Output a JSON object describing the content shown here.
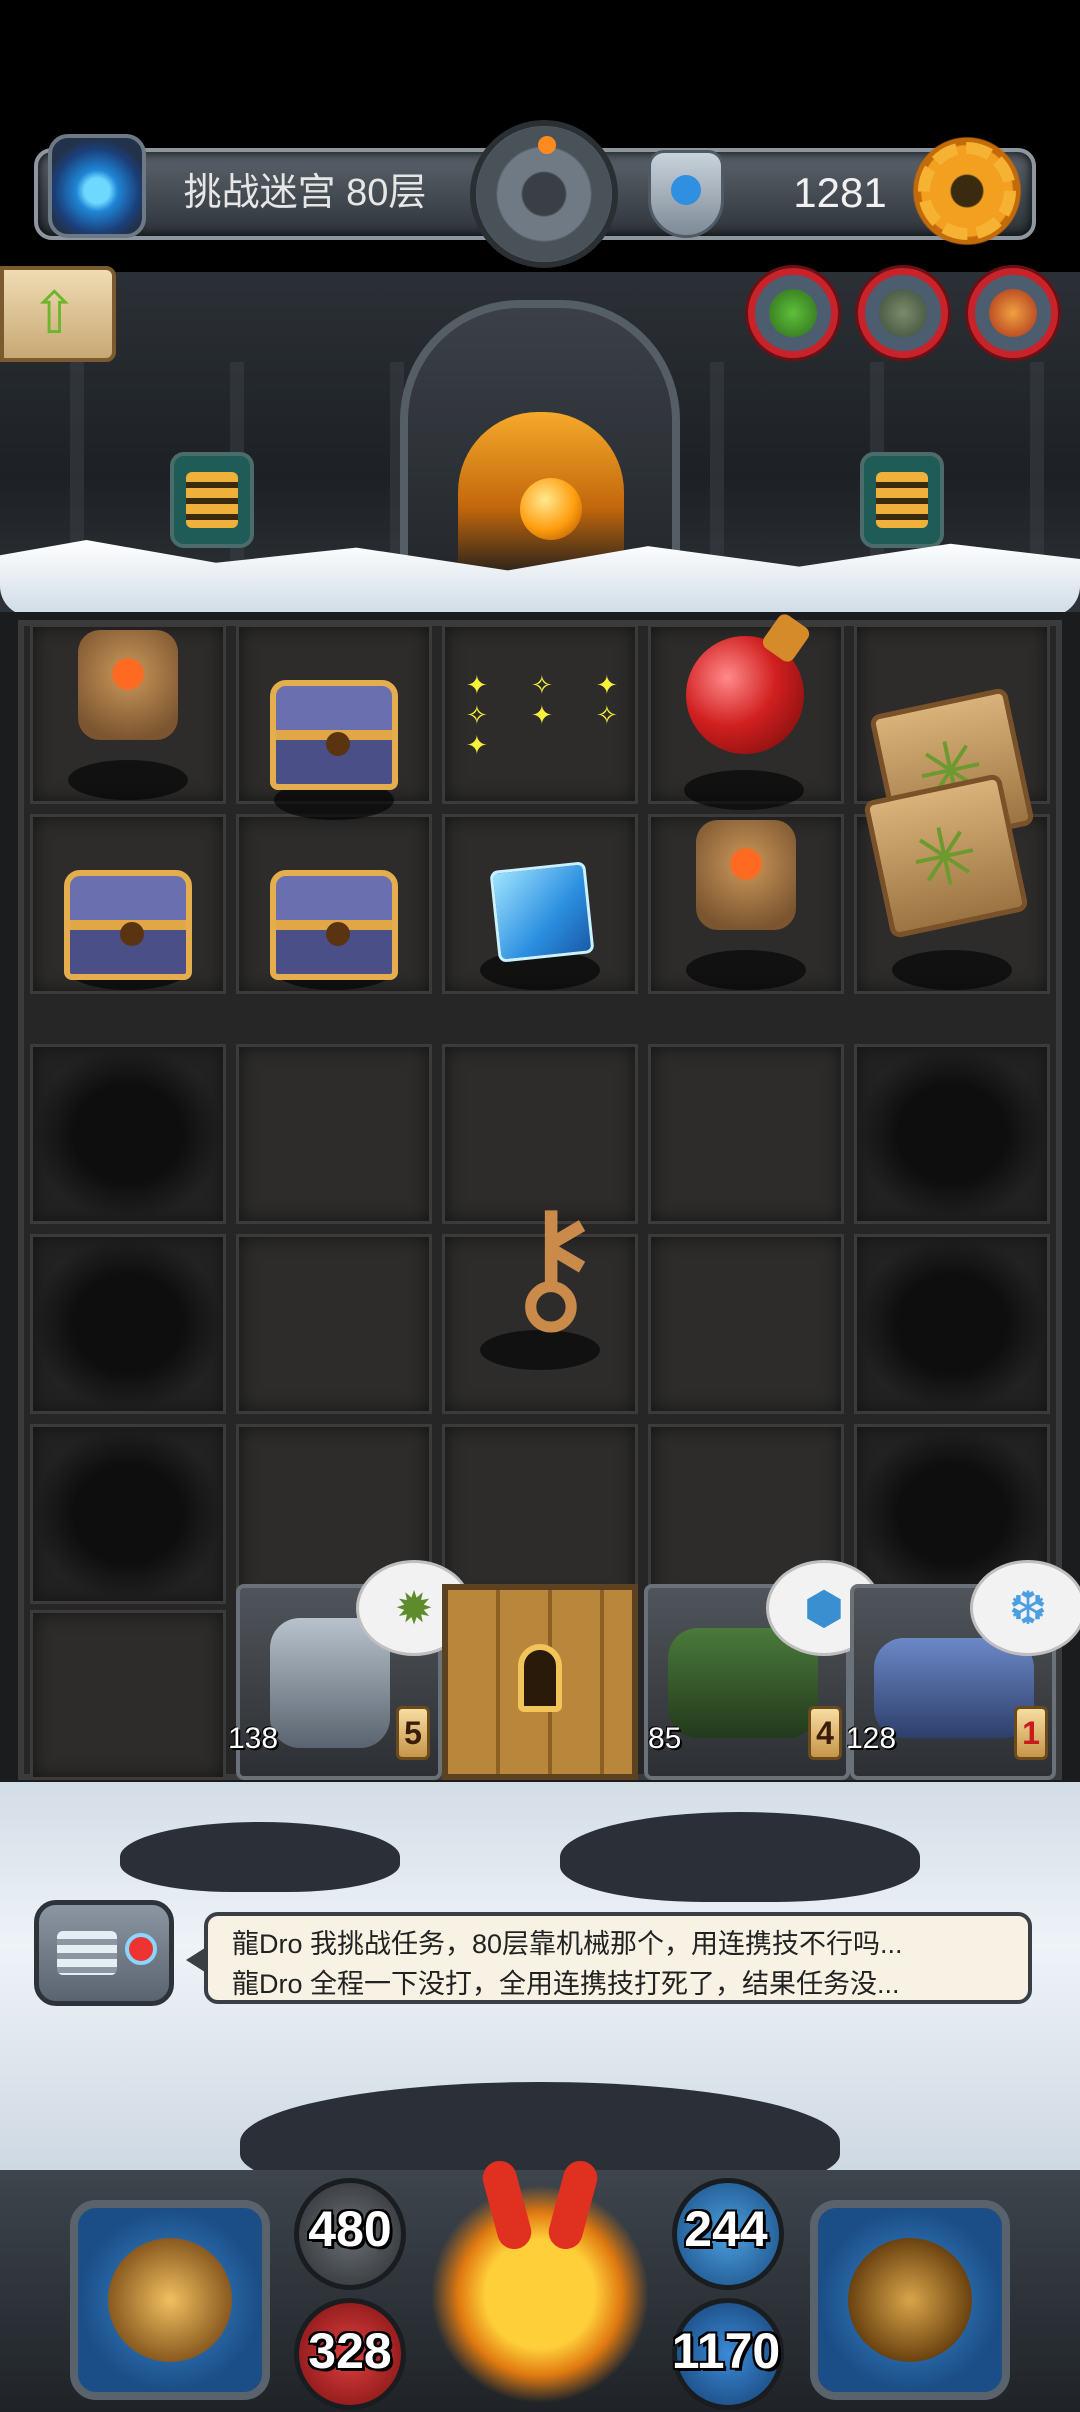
{
  "header": {
    "floor_label": "挑战迷宫 80层",
    "gold": "1281",
    "icons": {
      "portal": "portal-icon",
      "emblem": "bomb-emblem-icon",
      "mask": "mask-icon",
      "settings": "gear-icon"
    }
  },
  "nav": {
    "up_icon": "arrow-up-icon"
  },
  "monsters": [
    "green-goblin",
    "grey-troll",
    "red-imp"
  ],
  "board": {
    "items": [
      "fire-stone",
      "treasure-chest",
      "sparkles",
      "red-potion",
      "scroll",
      "treasure-chest",
      "treasure-chest",
      "ice-cube",
      "fire-stone",
      "scroll",
      "key"
    ]
  },
  "units": {
    "mech": {
      "attack": "138",
      "count": "5",
      "bubble_icon": "grenade-icon"
    },
    "tank": {
      "attack": "85",
      "count": "4",
      "bubble_icon": "turtle-shell-icon"
    },
    "cannon": {
      "attack": "128",
      "count": "1",
      "bubble_icon": "ice-shard-icon"
    },
    "door": "locked-door"
  },
  "chat": {
    "lines": [
      "龍Dro 我挑战任务，80层靠机械那个，用连携技不行吗...",
      "龍Dro 全程一下没打，全用连携技打死了，结果任务没..."
    ]
  },
  "hud": {
    "attack": "480",
    "hp": "328",
    "defense": "244",
    "mana": "1170",
    "left_slot": "armor-icon",
    "right_slot": "backpack-icon",
    "hero": "monkey-king-avatar"
  }
}
